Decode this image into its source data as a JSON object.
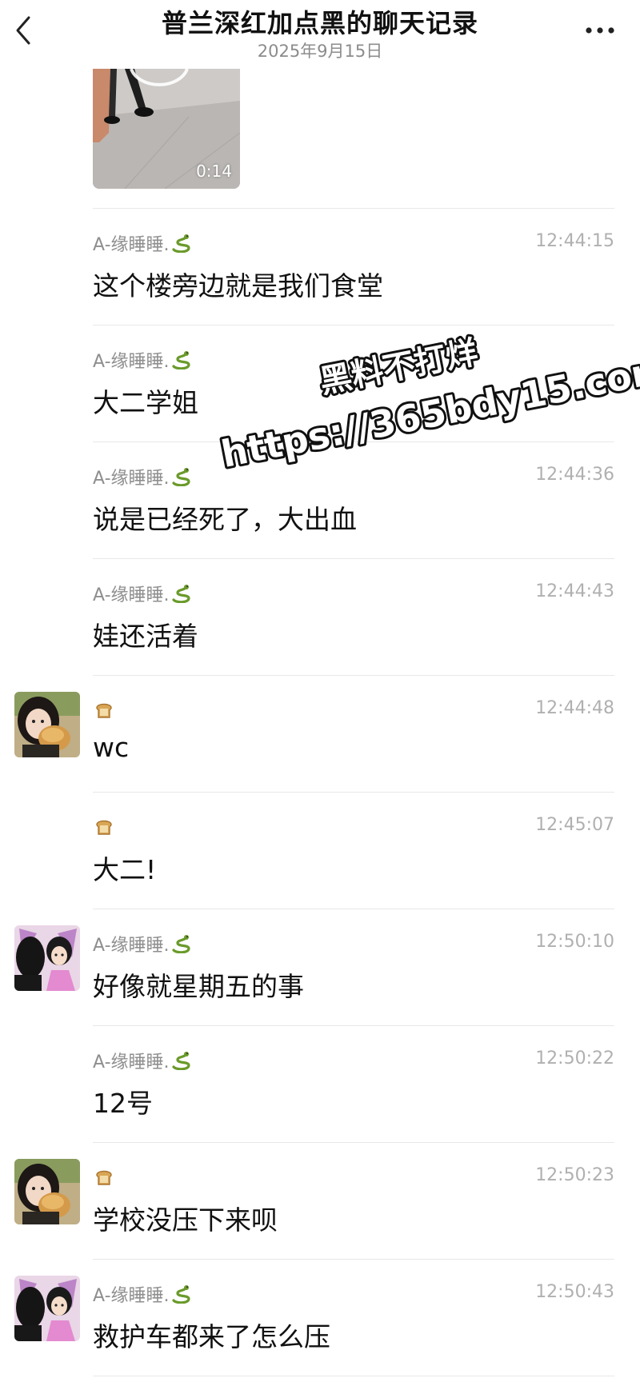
{
  "header": {
    "title": "普兰深红加点黑的聊天记录",
    "subtitle": "2025年9月15日",
    "back_icon": "chevron-left-icon",
    "more_icon": "more-horizontal-icon"
  },
  "video": {
    "duration": "0:14"
  },
  "messages": [
    {
      "sender": "A-缘睡睡.",
      "emoji": "snake",
      "time": "12:44:15",
      "text": "这个楼旁边就是我们食堂",
      "avatar": "none"
    },
    {
      "sender": "A-缘睡睡.",
      "emoji": "snake",
      "time": "",
      "text": "大二学姐",
      "avatar": "none"
    },
    {
      "sender": "A-缘睡睡.",
      "emoji": "snake",
      "time": "12:44:36",
      "text": "说是已经死了，大出血",
      "avatar": "none"
    },
    {
      "sender": "A-缘睡睡.",
      "emoji": "snake",
      "time": "12:44:43",
      "text": "娃还活着",
      "avatar": "none"
    },
    {
      "sender": "",
      "emoji": "bread",
      "time": "12:44:48",
      "text": "wc",
      "avatar": "girl-bread"
    },
    {
      "sender": "",
      "emoji": "bread",
      "time": "12:45:07",
      "text": "大二!",
      "avatar": "none"
    },
    {
      "sender": "A-缘睡睡.",
      "emoji": "snake",
      "time": "12:50:10",
      "text": "好像就星期五的事",
      "avatar": "anime-fairy"
    },
    {
      "sender": "A-缘睡睡.",
      "emoji": "snake",
      "time": "12:50:22",
      "text": "12号",
      "avatar": "none"
    },
    {
      "sender": "",
      "emoji": "bread",
      "time": "12:50:23",
      "text": "学校没压下来呗",
      "avatar": "girl-bread"
    },
    {
      "sender": "A-缘睡睡.",
      "emoji": "snake",
      "time": "12:50:43",
      "text": "救护车都来了怎么压",
      "avatar": "anime-fairy"
    }
  ],
  "watermark": {
    "line1": "黑料不打烊",
    "line2": "https://365bdy15.com"
  }
}
